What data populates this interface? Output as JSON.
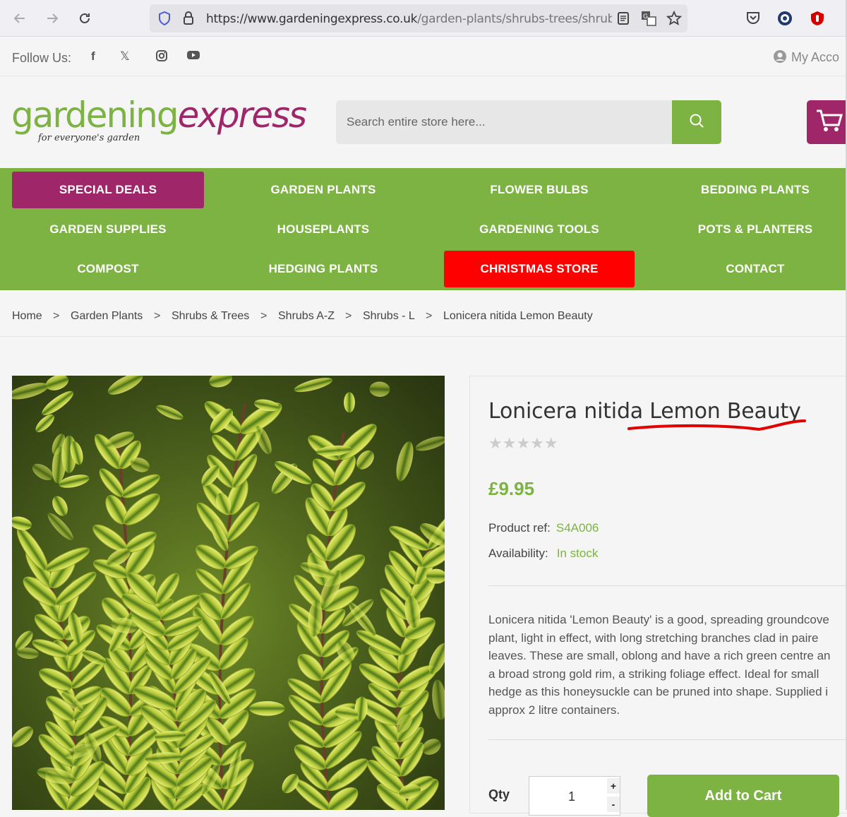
{
  "browser": {
    "url_main": "https://www.gardeningexpress.co.uk",
    "url_path": "/garden-plants/shrubs-trees/shrubs-a"
  },
  "topbar": {
    "follow_label": "Follow Us:",
    "account_label": "My Acco"
  },
  "header": {
    "logo_gardening": "gardening",
    "logo_express": "express",
    "logo_tagline": "for everyone's garden",
    "search_placeholder": "Search entire store here..."
  },
  "nav": {
    "items": [
      "SPECIAL DEALS",
      "GARDEN PLANTS",
      "FLOWER BULBS",
      "BEDDING PLANTS",
      "GARDEN SUPPLIES",
      "HOUSEPLANTS",
      "GARDENING TOOLS",
      "POTS & PLANTERS",
      "COMPOST",
      "HEDGING PLANTS",
      "CHRISTMAS STORE",
      "CONTACT"
    ]
  },
  "breadcrumb": {
    "items": [
      "Home",
      "Garden Plants",
      "Shrubs & Trees",
      "Shrubs A-Z",
      "Shrubs - L",
      "Lonicera nitida Lemon Beauty"
    ],
    "separator": ">"
  },
  "product": {
    "title": "Lonicera nitida Lemon Beauty",
    "rating_stars": "★★★★★",
    "rating_value": 0,
    "price": "£9.95",
    "ref_label": "Product ref:",
    "ref_value": "S4A006",
    "availability_label": "Availability:",
    "availability_value": "In stock",
    "description": "Lonicera nitida 'Lemon Beauty' is a good, spreading groundcove\nplant, light in effect, with long stretching branches clad in paire\nleaves. These are small, oblong and have a rich green centre an\na broad strong gold rim, a striking foliage effect. Ideal for small\nhedge as this honeysuckle can be pruned into shape. Supplied i\napprox 2 litre containers.",
    "qty_label": "Qty",
    "qty_value": "1",
    "qty_plus": "+",
    "qty_minus": "-",
    "add_to_cart": "Add to Cart"
  },
  "colors": {
    "brand_green": "#7cb342",
    "brand_purple": "#a0266a",
    "christmas_red": "#ff0000",
    "annotation_red": "#e00000"
  }
}
